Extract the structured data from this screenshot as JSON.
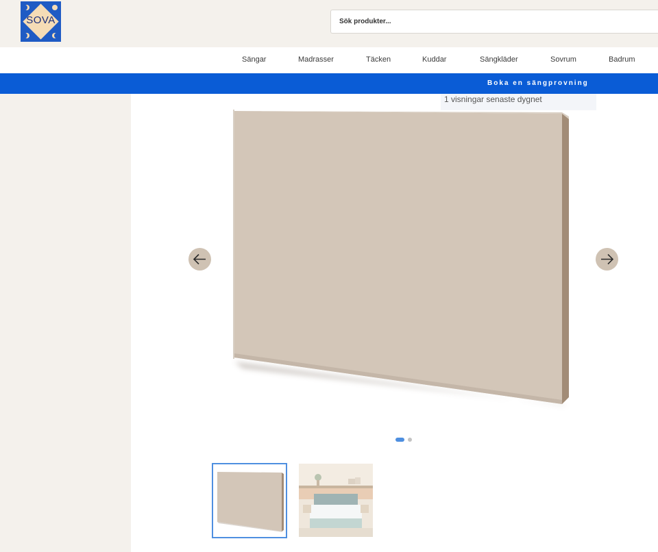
{
  "brand": {
    "logo_text": "SOVA",
    "accent": "#0a5cd6"
  },
  "search": {
    "placeholder": "Sök produkter..."
  },
  "nav": {
    "items": [
      {
        "label": "Sängar"
      },
      {
        "label": "Madrasser"
      },
      {
        "label": "Täcken"
      },
      {
        "label": "Kuddar"
      },
      {
        "label": "Sängkläder"
      },
      {
        "label": "Sovrum"
      },
      {
        "label": "Badrum"
      }
    ]
  },
  "banner": {
    "text": "Boka en sängprovning"
  },
  "product": {
    "views_text": "1 visningar senaste dygnet",
    "gallery": {
      "slide_count": 2,
      "active_slide": 1,
      "prev_icon": "arrow-left-icon",
      "next_icon": "arrow-right-icon"
    }
  }
}
